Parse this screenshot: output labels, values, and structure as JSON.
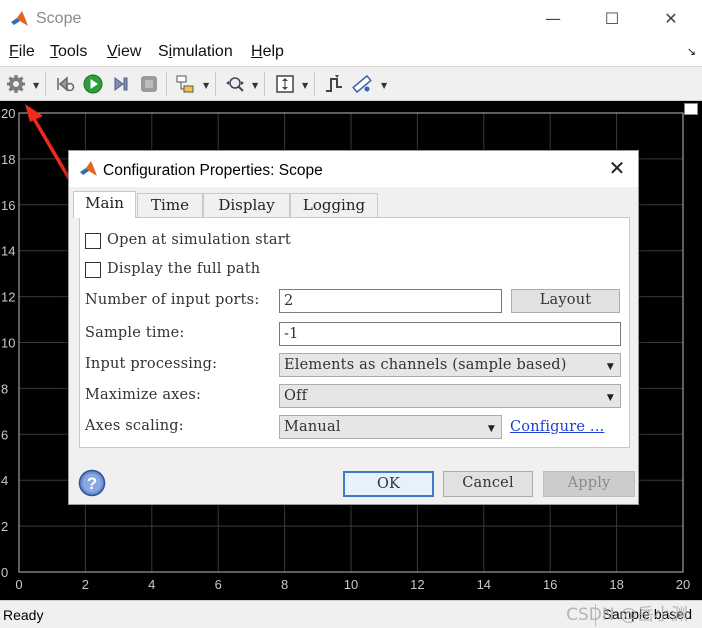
{
  "window": {
    "title": "Scope",
    "menu": [
      {
        "pre": "",
        "u": "F",
        "post": "ile"
      },
      {
        "pre": "",
        "u": "T",
        "post": "ools"
      },
      {
        "pre": "",
        "u": "V",
        "post": "iew"
      },
      {
        "pre": "S",
        "u": "i",
        "post": "mulation"
      },
      {
        "pre": "",
        "u": "H",
        "post": "elp"
      }
    ],
    "menu_pin": "↘"
  },
  "plot": {
    "x_ticks": [
      "0",
      "2",
      "4",
      "6",
      "8",
      "10",
      "12",
      "14",
      "16",
      "18",
      "20"
    ],
    "y_ticks": [
      "0",
      "2",
      "4",
      "6",
      "8",
      "10",
      "12",
      "14",
      "16",
      "18",
      "20"
    ],
    "xlim": [
      0,
      20
    ],
    "ylim": [
      0,
      20
    ],
    "background": "#000000",
    "grid_color": "#3a3a3a"
  },
  "status": {
    "left": "Ready",
    "right": "Sample based"
  },
  "watermark": "CSDN @岳小渊",
  "dialog": {
    "title": "Configuration Properties: Scope",
    "close_glyph": "✕",
    "tabs": [
      "Main",
      "Time",
      "Display",
      "Logging"
    ],
    "active_tab": "Main",
    "open_at_start": {
      "label": "Open at simulation start",
      "checked": false
    },
    "display_full_path": {
      "label": "Display the full path",
      "checked": false
    },
    "num_input_ports": {
      "label": "Number of input ports:",
      "value": "2"
    },
    "layout_button": "Layout",
    "sample_time": {
      "label": "Sample time:",
      "value": "-1"
    },
    "input_processing": {
      "label": "Input processing:",
      "value": "Elements as channels (sample based)"
    },
    "maximize_axes": {
      "label": "Maximize axes:",
      "value": "Off"
    },
    "axes_scaling": {
      "label": "Axes scaling:",
      "value": "Manual"
    },
    "configure_link": "Configure ...",
    "ok": "OK",
    "cancel": "Cancel",
    "apply": "Apply"
  }
}
